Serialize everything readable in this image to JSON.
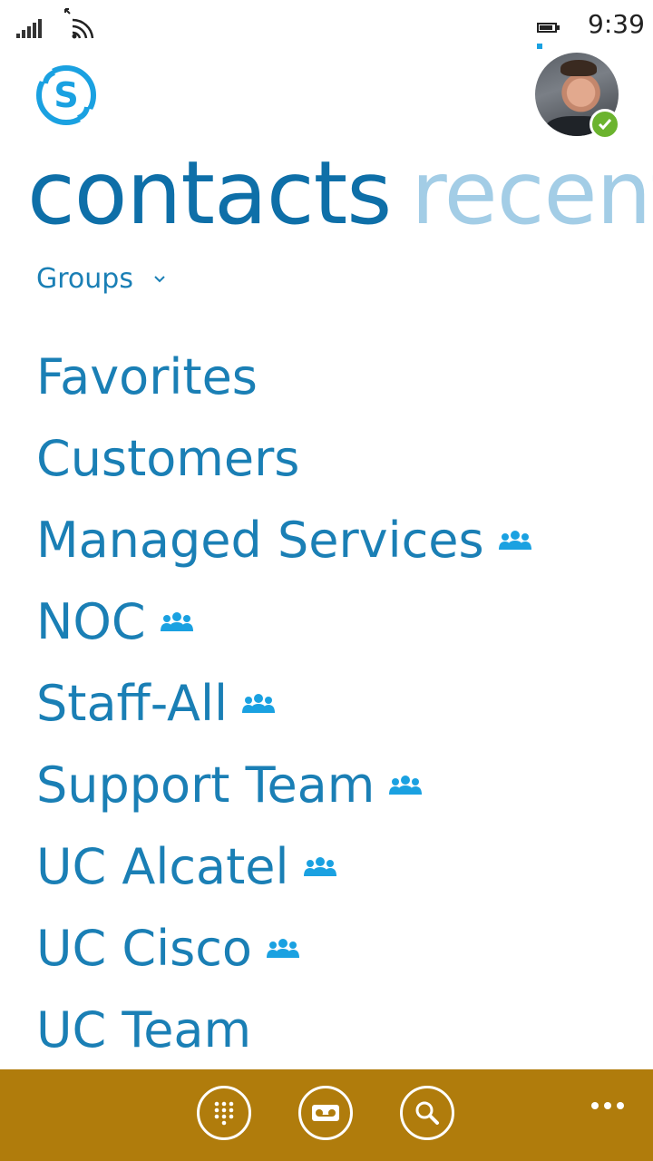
{
  "status_bar": {
    "time": "9:39"
  },
  "header": {
    "app_logo_icon": "skype-icon",
    "avatar_presence": "available"
  },
  "pivot": {
    "active_label": "contacts",
    "next_label": "recent"
  },
  "groups_toggle": {
    "label": "Groups"
  },
  "groups": [
    {
      "name": "Favorites",
      "distribution": false
    },
    {
      "name": "Customers",
      "distribution": false
    },
    {
      "name": "Managed Services",
      "distribution": true
    },
    {
      "name": "NOC",
      "distribution": true
    },
    {
      "name": "Staff-All",
      "distribution": true
    },
    {
      "name": "Support Team",
      "distribution": true
    },
    {
      "name": "UC Alcatel",
      "distribution": true
    },
    {
      "name": "UC Cisco",
      "distribution": true
    },
    {
      "name": "UC Team",
      "distribution": false
    }
  ],
  "app_bar": {
    "buttons": [
      "dialpad-icon",
      "voicemail-icon",
      "search-icon"
    ],
    "more": "more-icon"
  },
  "colors": {
    "accent": "#1a7fb5",
    "app_bar": "#b07c0c",
    "presence": "#6bb32e"
  }
}
